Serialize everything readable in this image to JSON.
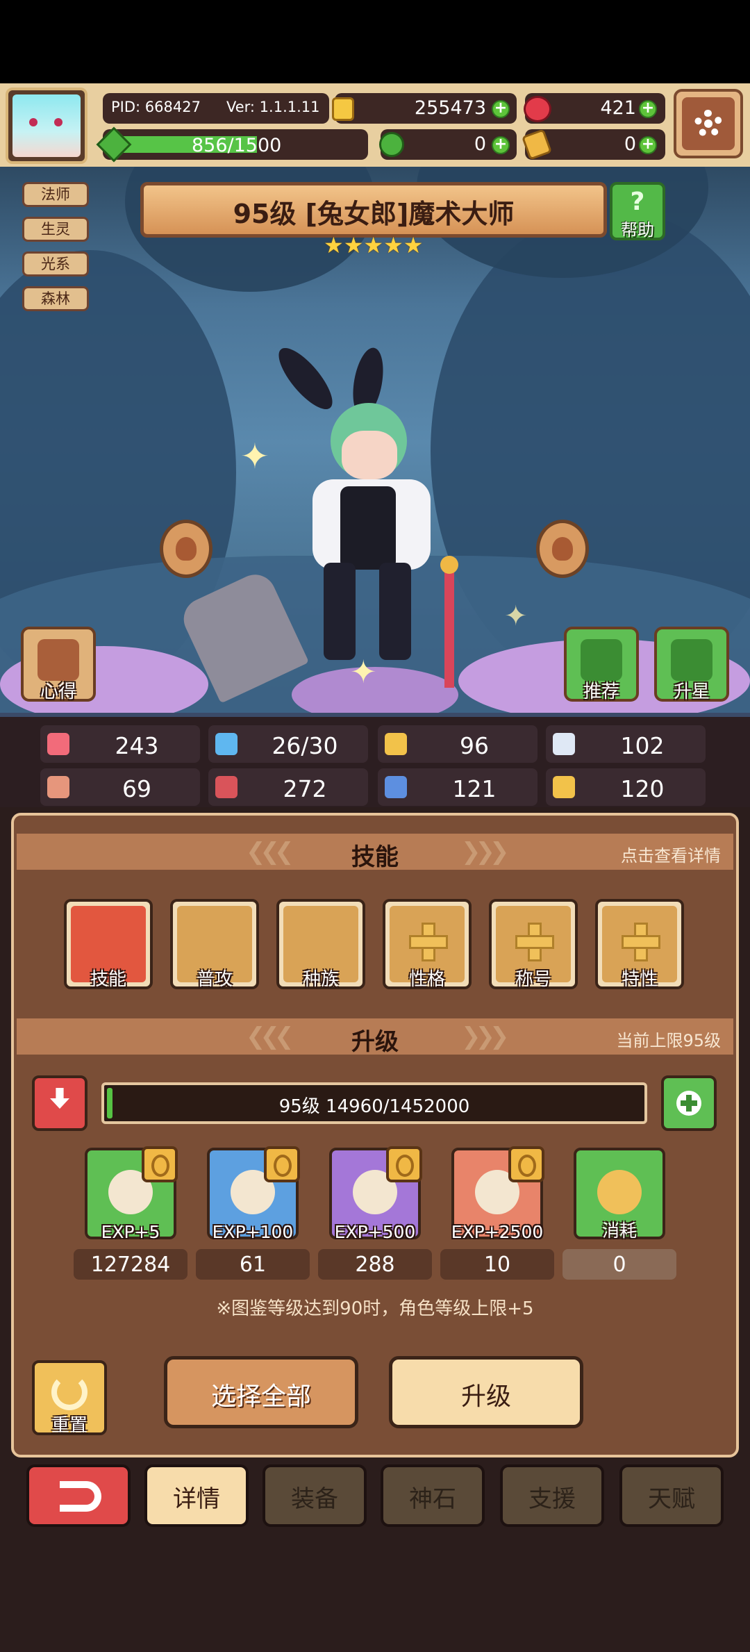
{
  "top": {
    "pid": "PID: 668427",
    "version": "Ver: 1.1.1.11",
    "gold": "255473",
    "gems": "421",
    "stamina": "856/1500",
    "stamina_fraction": 0.571,
    "clover": "0",
    "ticket": "0"
  },
  "tags": [
    "法师",
    "生灵",
    "光系",
    "森林"
  ],
  "hero": {
    "title": "95级 [兔女郎]魔术大师",
    "stars": 5,
    "help_label": "帮助"
  },
  "side_buttons": {
    "notes": "心得",
    "recommend": "推荐",
    "star_up": "升星"
  },
  "stats": [
    {
      "icon": "heart-icon",
      "value": "243"
    },
    {
      "icon": "water-drop-icon",
      "value": "26/30"
    },
    {
      "icon": "shield-icon",
      "value": "96"
    },
    {
      "icon": "wing-icon",
      "value": "102"
    },
    {
      "icon": "fist-icon",
      "value": "69"
    },
    {
      "icon": "book-icon",
      "value": "272"
    },
    {
      "icon": "boot-icon",
      "value": "121"
    },
    {
      "icon": "horseshoe-icon",
      "value": "120"
    }
  ],
  "skills_section": {
    "title": "技能",
    "right_text": "点击查看详情",
    "items": [
      "技能",
      "普攻",
      "种族",
      "性格",
      "称号",
      "特性"
    ]
  },
  "upgrade_section": {
    "title": "升级",
    "right_text": "当前上限95级",
    "exp_text": "95级  14960/1452000",
    "exp_fraction": 0.01,
    "items": [
      {
        "label": "EXP+5",
        "count": "127284"
      },
      {
        "label": "EXP+100",
        "count": "61"
      },
      {
        "label": "EXP+500",
        "count": "288"
      },
      {
        "label": "EXP+2500",
        "count": "10"
      },
      {
        "label": "消耗",
        "count": "0"
      }
    ],
    "note": "※图鉴等级达到90时，角色等级上限+5"
  },
  "actions": {
    "reset": "重置",
    "select_all": "选择全部",
    "upgrade": "升级"
  },
  "tabs": [
    "详情",
    "装备",
    "神石",
    "支援",
    "天赋"
  ],
  "colors": {
    "accent_green": "#56c243",
    "gold": "#f0c05a",
    "back_red": "#e04a4a"
  }
}
